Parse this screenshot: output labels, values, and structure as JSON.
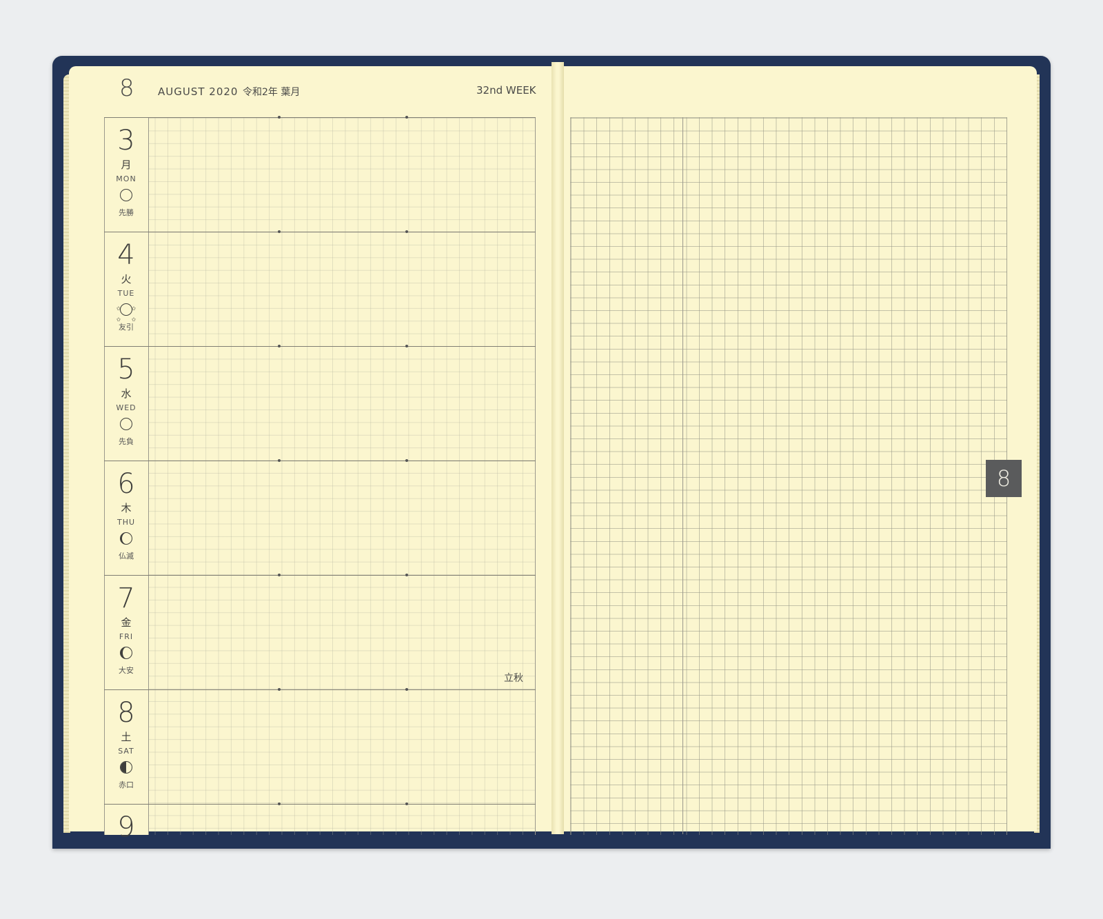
{
  "header_left": {
    "month_number": "8",
    "month_en": "AUGUST 2020",
    "month_jp": "令和2年 葉月",
    "week": "32nd WEEK"
  },
  "days": [
    {
      "num": "3",
      "kanji": "月",
      "en": "MON",
      "rokuyo": "先勝",
      "moon": "full"
    },
    {
      "num": "4",
      "kanji": "火",
      "en": "TUE",
      "rokuyo": "友引",
      "moon": "full-stars"
    },
    {
      "num": "5",
      "kanji": "水",
      "en": "WED",
      "rokuyo": "先負",
      "moon": "full"
    },
    {
      "num": "6",
      "kanji": "木",
      "en": "THU",
      "rokuyo": "仏滅",
      "moon": "waning"
    },
    {
      "num": "7",
      "kanji": "金",
      "en": "FRI",
      "rokuyo": "大安",
      "moon": "waning"
    },
    {
      "num": "8",
      "kanji": "土",
      "en": "SAT",
      "rokuyo": "赤口",
      "moon": "half"
    },
    {
      "num": "9",
      "kanji": "",
      "en": "",
      "rokuyo": "",
      "moon": ""
    }
  ],
  "notes": {
    "risshu": "立秋"
  },
  "tab": {
    "month_number": "8"
  },
  "colors": {
    "cover": "#223457",
    "paper": "#fbf6cf",
    "tab": "#5a5b5c"
  }
}
